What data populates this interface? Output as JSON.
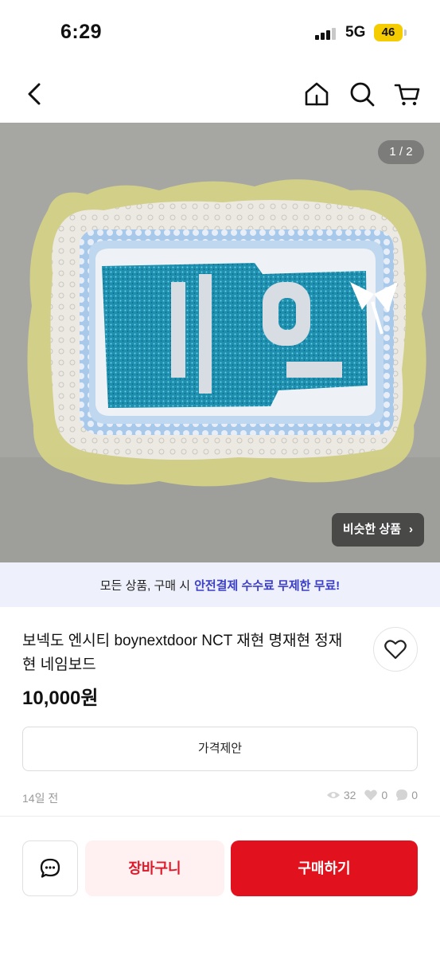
{
  "status_bar": {
    "time": "6:29",
    "network": "5G",
    "battery": "46"
  },
  "nav": {
    "back_icon": "chevron-left-icon",
    "home_icon": "home-icon",
    "search_icon": "search-icon",
    "cart_icon": "cart-icon"
  },
  "hero": {
    "page_indicator": "1 / 2",
    "similar_label": "비슷한 상품",
    "similar_chevron": "›"
  },
  "promo": {
    "text": "모든 상품, 구매 시",
    "highlight": "안전결제 수수료 무제한 무료!"
  },
  "product": {
    "title": "보넥도 엔시티 boynextdoor NCT 재현 명재현 정재현 네임보드",
    "price": "10,000원",
    "offer_label": "가격제안",
    "posted": "14일 전",
    "views": "32",
    "likes": "0",
    "chats": "0"
  },
  "bottom_bar": {
    "cart_label": "장바구니",
    "buy_label": "구매하기"
  },
  "colors": {
    "accent_red": "#e1121e",
    "cart_bg": "#fff0f1",
    "promo_bg": "#eef0fb",
    "promo_highlight": "#3b3fc7"
  }
}
